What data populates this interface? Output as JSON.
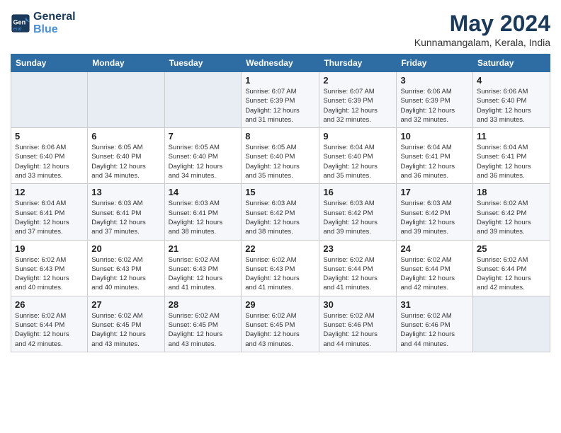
{
  "header": {
    "logo_line1": "General",
    "logo_line2": "Blue",
    "month_year": "May 2024",
    "location": "Kunnamangalam, Kerala, India"
  },
  "days_of_week": [
    "Sunday",
    "Monday",
    "Tuesday",
    "Wednesday",
    "Thursday",
    "Friday",
    "Saturday"
  ],
  "weeks": [
    [
      {
        "day": "",
        "info": ""
      },
      {
        "day": "",
        "info": ""
      },
      {
        "day": "",
        "info": ""
      },
      {
        "day": "1",
        "info": "Sunrise: 6:07 AM\nSunset: 6:39 PM\nDaylight: 12 hours\nand 31 minutes."
      },
      {
        "day": "2",
        "info": "Sunrise: 6:07 AM\nSunset: 6:39 PM\nDaylight: 12 hours\nand 32 minutes."
      },
      {
        "day": "3",
        "info": "Sunrise: 6:06 AM\nSunset: 6:39 PM\nDaylight: 12 hours\nand 32 minutes."
      },
      {
        "day": "4",
        "info": "Sunrise: 6:06 AM\nSunset: 6:40 PM\nDaylight: 12 hours\nand 33 minutes."
      }
    ],
    [
      {
        "day": "5",
        "info": "Sunrise: 6:06 AM\nSunset: 6:40 PM\nDaylight: 12 hours\nand 33 minutes."
      },
      {
        "day": "6",
        "info": "Sunrise: 6:05 AM\nSunset: 6:40 PM\nDaylight: 12 hours\nand 34 minutes."
      },
      {
        "day": "7",
        "info": "Sunrise: 6:05 AM\nSunset: 6:40 PM\nDaylight: 12 hours\nand 34 minutes."
      },
      {
        "day": "8",
        "info": "Sunrise: 6:05 AM\nSunset: 6:40 PM\nDaylight: 12 hours\nand 35 minutes."
      },
      {
        "day": "9",
        "info": "Sunrise: 6:04 AM\nSunset: 6:40 PM\nDaylight: 12 hours\nand 35 minutes."
      },
      {
        "day": "10",
        "info": "Sunrise: 6:04 AM\nSunset: 6:41 PM\nDaylight: 12 hours\nand 36 minutes."
      },
      {
        "day": "11",
        "info": "Sunrise: 6:04 AM\nSunset: 6:41 PM\nDaylight: 12 hours\nand 36 minutes."
      }
    ],
    [
      {
        "day": "12",
        "info": "Sunrise: 6:04 AM\nSunset: 6:41 PM\nDaylight: 12 hours\nand 37 minutes."
      },
      {
        "day": "13",
        "info": "Sunrise: 6:03 AM\nSunset: 6:41 PM\nDaylight: 12 hours\nand 37 minutes."
      },
      {
        "day": "14",
        "info": "Sunrise: 6:03 AM\nSunset: 6:41 PM\nDaylight: 12 hours\nand 38 minutes."
      },
      {
        "day": "15",
        "info": "Sunrise: 6:03 AM\nSunset: 6:42 PM\nDaylight: 12 hours\nand 38 minutes."
      },
      {
        "day": "16",
        "info": "Sunrise: 6:03 AM\nSunset: 6:42 PM\nDaylight: 12 hours\nand 39 minutes."
      },
      {
        "day": "17",
        "info": "Sunrise: 6:03 AM\nSunset: 6:42 PM\nDaylight: 12 hours\nand 39 minutes."
      },
      {
        "day": "18",
        "info": "Sunrise: 6:02 AM\nSunset: 6:42 PM\nDaylight: 12 hours\nand 39 minutes."
      }
    ],
    [
      {
        "day": "19",
        "info": "Sunrise: 6:02 AM\nSunset: 6:43 PM\nDaylight: 12 hours\nand 40 minutes."
      },
      {
        "day": "20",
        "info": "Sunrise: 6:02 AM\nSunset: 6:43 PM\nDaylight: 12 hours\nand 40 minutes."
      },
      {
        "day": "21",
        "info": "Sunrise: 6:02 AM\nSunset: 6:43 PM\nDaylight: 12 hours\nand 41 minutes."
      },
      {
        "day": "22",
        "info": "Sunrise: 6:02 AM\nSunset: 6:43 PM\nDaylight: 12 hours\nand 41 minutes."
      },
      {
        "day": "23",
        "info": "Sunrise: 6:02 AM\nSunset: 6:44 PM\nDaylight: 12 hours\nand 41 minutes."
      },
      {
        "day": "24",
        "info": "Sunrise: 6:02 AM\nSunset: 6:44 PM\nDaylight: 12 hours\nand 42 minutes."
      },
      {
        "day": "25",
        "info": "Sunrise: 6:02 AM\nSunset: 6:44 PM\nDaylight: 12 hours\nand 42 minutes."
      }
    ],
    [
      {
        "day": "26",
        "info": "Sunrise: 6:02 AM\nSunset: 6:44 PM\nDaylight: 12 hours\nand 42 minutes."
      },
      {
        "day": "27",
        "info": "Sunrise: 6:02 AM\nSunset: 6:45 PM\nDaylight: 12 hours\nand 43 minutes."
      },
      {
        "day": "28",
        "info": "Sunrise: 6:02 AM\nSunset: 6:45 PM\nDaylight: 12 hours\nand 43 minutes."
      },
      {
        "day": "29",
        "info": "Sunrise: 6:02 AM\nSunset: 6:45 PM\nDaylight: 12 hours\nand 43 minutes."
      },
      {
        "day": "30",
        "info": "Sunrise: 6:02 AM\nSunset: 6:46 PM\nDaylight: 12 hours\nand 44 minutes."
      },
      {
        "day": "31",
        "info": "Sunrise: 6:02 AM\nSunset: 6:46 PM\nDaylight: 12 hours\nand 44 minutes."
      },
      {
        "day": "",
        "info": ""
      }
    ]
  ]
}
